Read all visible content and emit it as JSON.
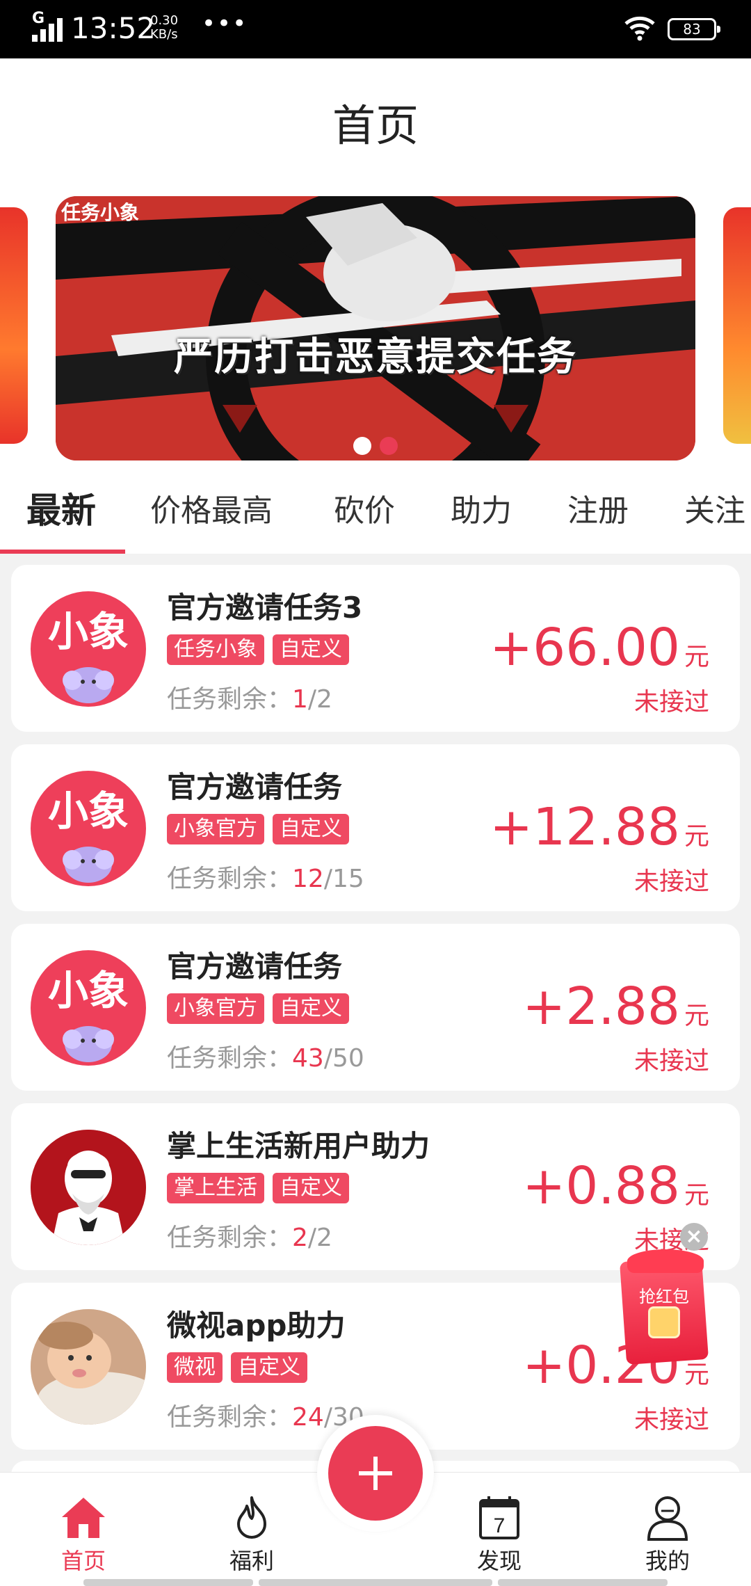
{
  "status_bar": {
    "time": "13:52",
    "network": "G",
    "speed_value": "0.30",
    "speed_unit": "KB/s",
    "more": "•••",
    "battery": "83"
  },
  "header": {
    "title": "首页"
  },
  "banner": {
    "brand": "任务小象",
    "slogan": "严历打击恶意提交任务",
    "slide_count": 2,
    "active_slide": 2
  },
  "tabs": [
    "最新",
    "价格最高",
    "砍价",
    "助力",
    "注册",
    "关注"
  ],
  "active_tab": "最新",
  "tasks": [
    {
      "title": "官方邀请任务3",
      "tags": [
        "任务小象",
        "自定义"
      ],
      "remain_label": "任务剩余：",
      "remain_current": "1",
      "remain_total": "/2",
      "amount": "+66.00",
      "unit": "元",
      "status": "未接过",
      "avatar": "xiaoxiang"
    },
    {
      "title": "官方邀请任务",
      "tags": [
        "小象官方",
        "自定义"
      ],
      "remain_label": "任务剩余：",
      "remain_current": "12",
      "remain_total": "/15",
      "amount": "+12.88",
      "unit": "元",
      "status": "未接过",
      "avatar": "xiaoxiang"
    },
    {
      "title": "官方邀请任务",
      "tags": [
        "小象官方",
        "自定义"
      ],
      "remain_label": "任务剩余：",
      "remain_current": "43",
      "remain_total": "/50",
      "amount": "+2.88",
      "unit": "元",
      "status": "未接过",
      "avatar": "xiaoxiang"
    },
    {
      "title": "掌上生活新用户助力",
      "tags": [
        "掌上生活",
        "自定义"
      ],
      "remain_label": "任务剩余：",
      "remain_current": "2",
      "remain_total": "/2",
      "amount": "+0.88",
      "unit": "元",
      "status": "未接过",
      "avatar": "kfc"
    },
    {
      "title": "微视app助力",
      "tags": [
        "微视",
        "自定义"
      ],
      "remain_label": "任务剩余：",
      "remain_current": "24",
      "remain_total": "/30",
      "amount": "+0.20",
      "unit": "元",
      "status": "未接过",
      "avatar": "baby"
    }
  ],
  "avatar_text": "小象",
  "red_packet": {
    "label": "抢红包"
  },
  "bottom_nav": [
    {
      "label": "首页",
      "icon": "home-icon",
      "active": true
    },
    {
      "label": "福利",
      "icon": "flame-icon",
      "active": false
    },
    {
      "label": "发现",
      "icon": "calendar-icon",
      "active": false,
      "icon_text": "7"
    },
    {
      "label": "我的",
      "icon": "user-icon",
      "active": false
    }
  ],
  "colors": {
    "accent": "#ea3c55",
    "tag_bg": "#ef4a62",
    "background": "#f2f2f2"
  }
}
